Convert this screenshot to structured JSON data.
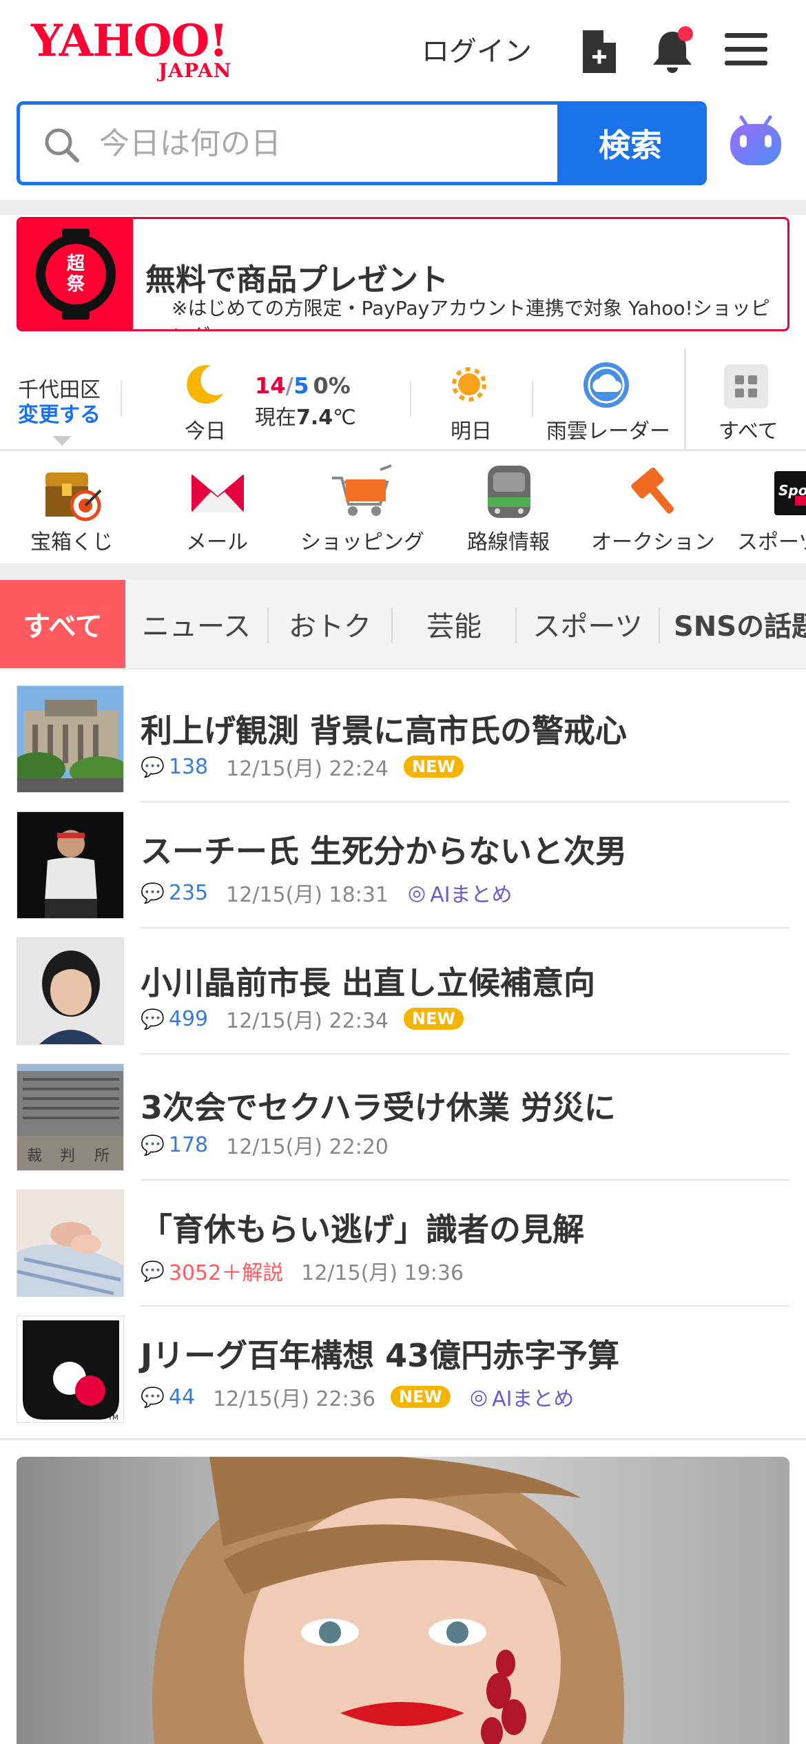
{
  "header": {
    "logo_main": "YAHOO!",
    "logo_sub": "JAPAN",
    "login_label": "ログイン",
    "icons": [
      "add-document-icon",
      "bell-icon",
      "menu-icon"
    ]
  },
  "search": {
    "placeholder": "今日は何の日",
    "button_label": "検索",
    "assistant_icon": "ai-assistant-icon"
  },
  "promo": {
    "badge_text": "超PayPay祭",
    "title": "無料で商品プレゼント",
    "subtitle": "※はじめての方限定・PayPayアカウント連携で対象 Yahoo!ショッピング"
  },
  "weather": {
    "location": "千代田区",
    "change_label": "変更する",
    "today_label": "今日",
    "high": "14",
    "slash": "/",
    "low": "5",
    "precip": "0%",
    "current_prefix": "現在",
    "current_temp": "7.4",
    "current_unit": "℃",
    "tomorrow_label": "明日",
    "radar_label": "雨雲レーダー",
    "all_label": "すべて"
  },
  "services": [
    {
      "label": "宝箱くじ",
      "icon": "treasure-box-icon"
    },
    {
      "label": "メール",
      "icon": "mail-icon"
    },
    {
      "label": "ショッピング",
      "icon": "shopping-cart-icon"
    },
    {
      "label": "路線情報",
      "icon": "train-icon"
    },
    {
      "label": "オークション",
      "icon": "auction-hammer-icon"
    },
    {
      "label": "スポーツ",
      "icon": "sports-icon"
    }
  ],
  "tabs": [
    "すべて",
    "ニュース",
    "おトク",
    "芸能",
    "スポーツ",
    "SNSの話題"
  ],
  "news": [
    {
      "title": "利上げ観測 背景に高市氏の警戒心",
      "comments": "138",
      "date": "12/15(月) 22:24",
      "new": "NEW",
      "ai": ""
    },
    {
      "title": "スーチー氏 生死分からないと次男",
      "comments": "235",
      "date": "12/15(月) 18:31",
      "new": "",
      "ai": "AIまとめ"
    },
    {
      "title": "小川晶前市長 出直し立候補意向",
      "comments": "499",
      "date": "12/15(月) 22:34",
      "new": "NEW",
      "ai": ""
    },
    {
      "title": "3次会でセクハラ受け休業 労災に",
      "comments": "178",
      "date": "12/15(月) 22:20",
      "new": "",
      "ai": ""
    },
    {
      "title": "「育休もらい逃げ」識者の見解",
      "comments": "3052＋解説",
      "date": "12/15(月) 19:36",
      "new": "",
      "ai": ""
    },
    {
      "title": "Jリーグ百年構想 43億円赤字予算",
      "comments": "44",
      "date": "12/15(月) 22:36",
      "new": "NEW",
      "ai": "AIまとめ"
    }
  ],
  "colors": {
    "brand_red": "#ff0033",
    "search_blue": "#1a73e8",
    "tab_active": "#ff5a5f",
    "new_badge": "#f5b400",
    "ai_purple": "#6a5acd"
  }
}
